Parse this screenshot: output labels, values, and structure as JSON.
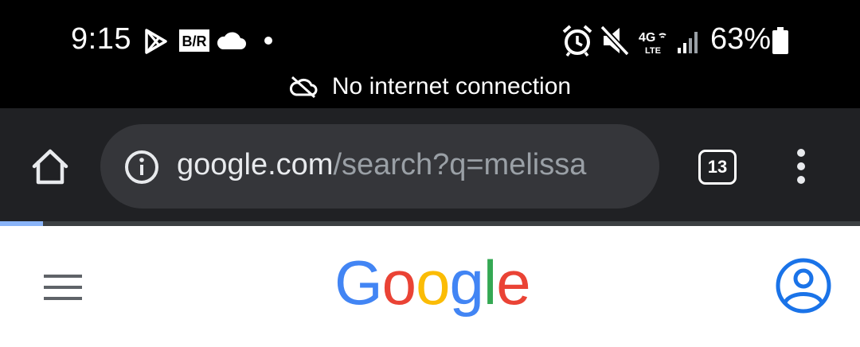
{
  "status_bar": {
    "time": "9:15",
    "battery_percent": "63%",
    "network": "4G LTE",
    "icons_left": [
      "play-store-icon",
      "bleacher-report-icon",
      "cloud-icon",
      "dot-icon"
    ],
    "icons_right": [
      "alarm-icon",
      "mute-icon",
      "4g-lte-icon",
      "signal-icon",
      "battery-icon"
    ],
    "battery_level": 0.63,
    "offline_message": "No internet connection"
  },
  "toolbar": {
    "url_host": "google.com",
    "url_path": "/search?q=melissa",
    "tab_count": "13",
    "load_progress": 0.05
  },
  "page": {
    "logo_letters": [
      "G",
      "o",
      "o",
      "g",
      "l",
      "e"
    ],
    "logo_colors": [
      "#4285F4",
      "#EA4335",
      "#FBBC05",
      "#4285F4",
      "#34A853",
      "#EA4335"
    ]
  },
  "colors": {
    "status_bg": "#000000",
    "toolbar_bg": "#202124",
    "omnibox_bg": "#35363a",
    "account_blue": "#1a73e8"
  }
}
